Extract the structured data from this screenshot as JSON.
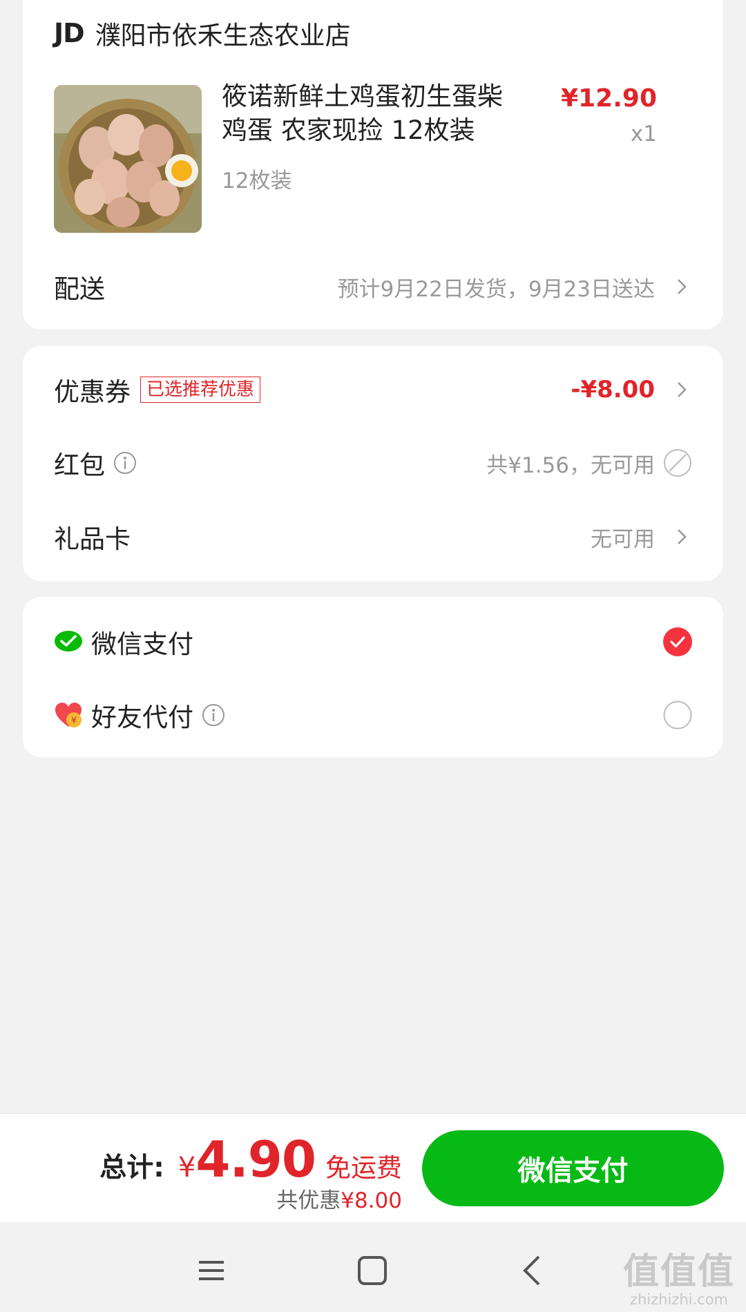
{
  "order": {
    "store": {
      "logo": "JD",
      "name": "濮阳市依禾生态农业店"
    },
    "product": {
      "title": "筱诺新鲜土鸡蛋初生蛋柴鸡蛋 农家现捡 12枚装",
      "spec": "12枚装",
      "price": "¥12.90",
      "quantity": "x1"
    },
    "delivery": {
      "label": "配送",
      "value": "预计9月22日发货，9月23日送达"
    }
  },
  "discounts": {
    "coupon": {
      "label": "优惠券",
      "badge": "已选推荐优惠",
      "value": "-¥8.00"
    },
    "red_packet": {
      "label": "红包",
      "value": "共¥1.56，无可用"
    },
    "gift_card": {
      "label": "礼品卡",
      "value": "无可用"
    }
  },
  "payment": {
    "wechat": {
      "label": "微信支付",
      "selected": true
    },
    "friend": {
      "label": "好友代付",
      "selected": false
    }
  },
  "footer": {
    "total_label": "总计:",
    "currency": "¥",
    "total_amount": "4.90",
    "free_shipping": "免运费",
    "saved_label": "共优惠",
    "saved_amount": "¥8.00",
    "pay_button": "微信支付"
  },
  "watermark": {
    "logo": "值值值",
    "url": "zhizhizhi.com"
  },
  "colors": {
    "accent_red": "#e0252a",
    "wechat_green": "#07b915"
  },
  "icons": [
    "chevron-right-icon",
    "info-icon",
    "unavailable-icon",
    "wechat-icon",
    "friend-pay-icon",
    "checked-icon",
    "unchecked-icon",
    "menu-icon",
    "home-icon",
    "back-icon"
  ]
}
